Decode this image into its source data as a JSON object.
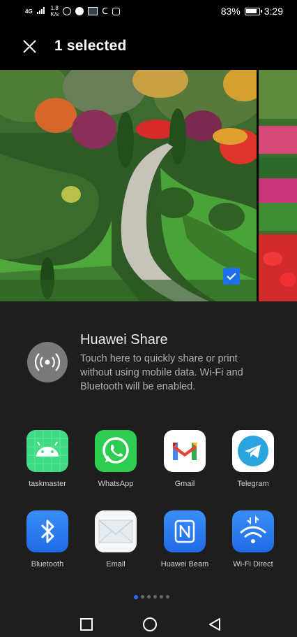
{
  "status_bar": {
    "network": "4G",
    "speed_value": "1.8",
    "speed_unit": "K/s",
    "battery": "83%",
    "time": "3:29"
  },
  "header": {
    "title": "1 selected"
  },
  "huawei_share": {
    "title": "Huawei Share",
    "description": "Touch here to quickly share or print without using mobile data. Wi-Fi and Bluetooth will be enabled."
  },
  "apps": [
    {
      "label": "taskmaster"
    },
    {
      "label": "WhatsApp"
    },
    {
      "label": "Gmail"
    },
    {
      "label": "Telegram"
    },
    {
      "label": "Bluetooth"
    },
    {
      "label": "Email"
    },
    {
      "label": "Huawei Beam"
    },
    {
      "label": "Wi-Fi Direct"
    }
  ],
  "pager": {
    "pages": 6,
    "active": 1
  },
  "colors": {
    "accent": "#1e6ff0",
    "sheet_background": "#1e1e1e"
  }
}
